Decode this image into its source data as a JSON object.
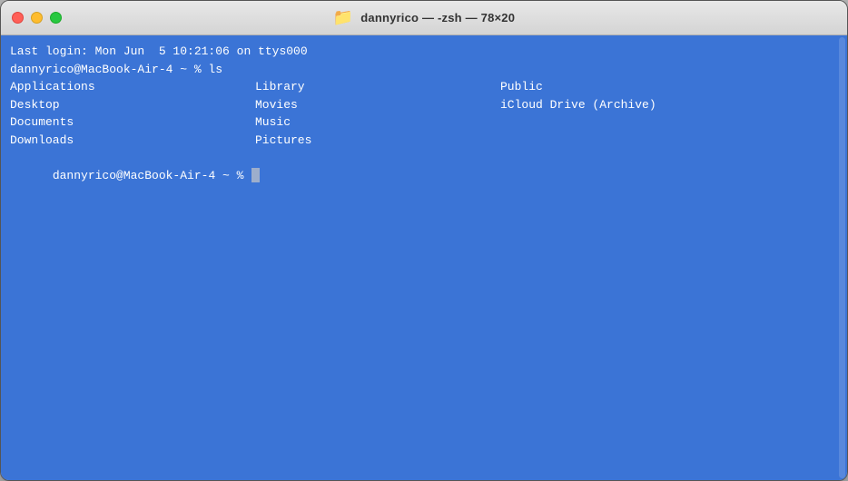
{
  "window": {
    "title": "dannyrico — -zsh — 78×20",
    "folder_icon": "📁"
  },
  "traffic_lights": {
    "close_label": "close",
    "minimize_label": "minimize",
    "maximize_label": "maximize"
  },
  "terminal": {
    "login_line": "Last login: Mon Jun  5 10:21:06 on ttys000",
    "prompt1": "dannyrico@MacBook-Air-4 ~ % ls",
    "prompt2": "dannyrico@MacBook-Air-4 ~ % ",
    "ls_columns": [
      [
        "Applications",
        "Desktop",
        "Documents",
        "Downloads"
      ],
      [
        "Library",
        "Movies",
        "Music",
        "Pictures"
      ],
      [
        "Public",
        "iCloud Drive (Archive)",
        "",
        ""
      ]
    ]
  }
}
